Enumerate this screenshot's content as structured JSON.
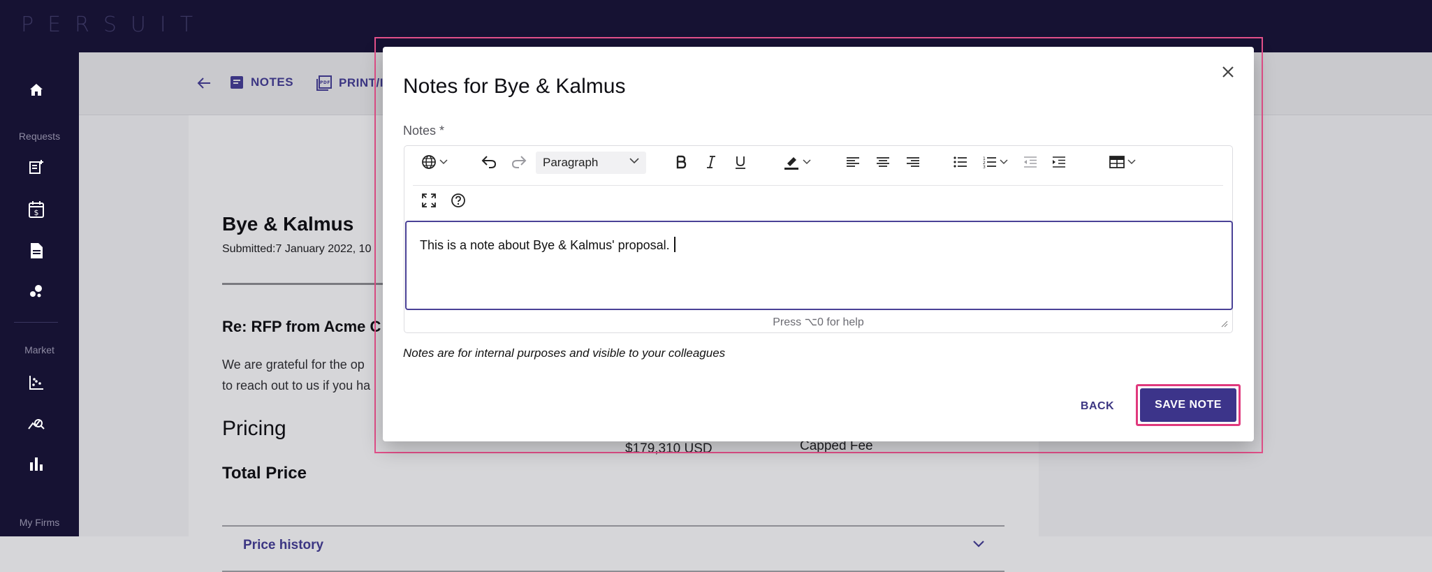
{
  "app": {
    "logo_text": "PERSUIT"
  },
  "sidebar": {
    "sections": [
      {
        "label": "Requests"
      },
      {
        "label": "Market"
      },
      {
        "label": "My Firms"
      }
    ]
  },
  "subnav": {
    "notes_label": "NOTES",
    "print_label": "PRINT/I"
  },
  "page": {
    "vendor_name": "Bye & Kalmus",
    "submitted": "Submitted:7 January 2022, 10",
    "re_heading": "Re: RFP from Acme C",
    "body_line1": "We are grateful for the op",
    "body_line2": "to reach out to us if you ha",
    "pricing_heading": "Pricing",
    "total_price_label": "Total Price",
    "total_price_value": "$179,310 USD",
    "fee_type": "Capped Fee",
    "price_history_label": "Price history"
  },
  "modal": {
    "title": "Notes for Bye & Kalmus",
    "notes_label": "Notes *",
    "editor": {
      "block_format": "Paragraph",
      "content": "This is a note about Bye & Kalmus' proposal.",
      "status_hint": "Press ⌥0 for help"
    },
    "footnote": "Notes are for internal purposes and visible to your colleagues",
    "back_label": "BACK",
    "save_label": "SAVE NOTE"
  },
  "colors": {
    "nav_bg": "#161233",
    "accent": "#3c348a",
    "highlight": "#e0397d"
  }
}
